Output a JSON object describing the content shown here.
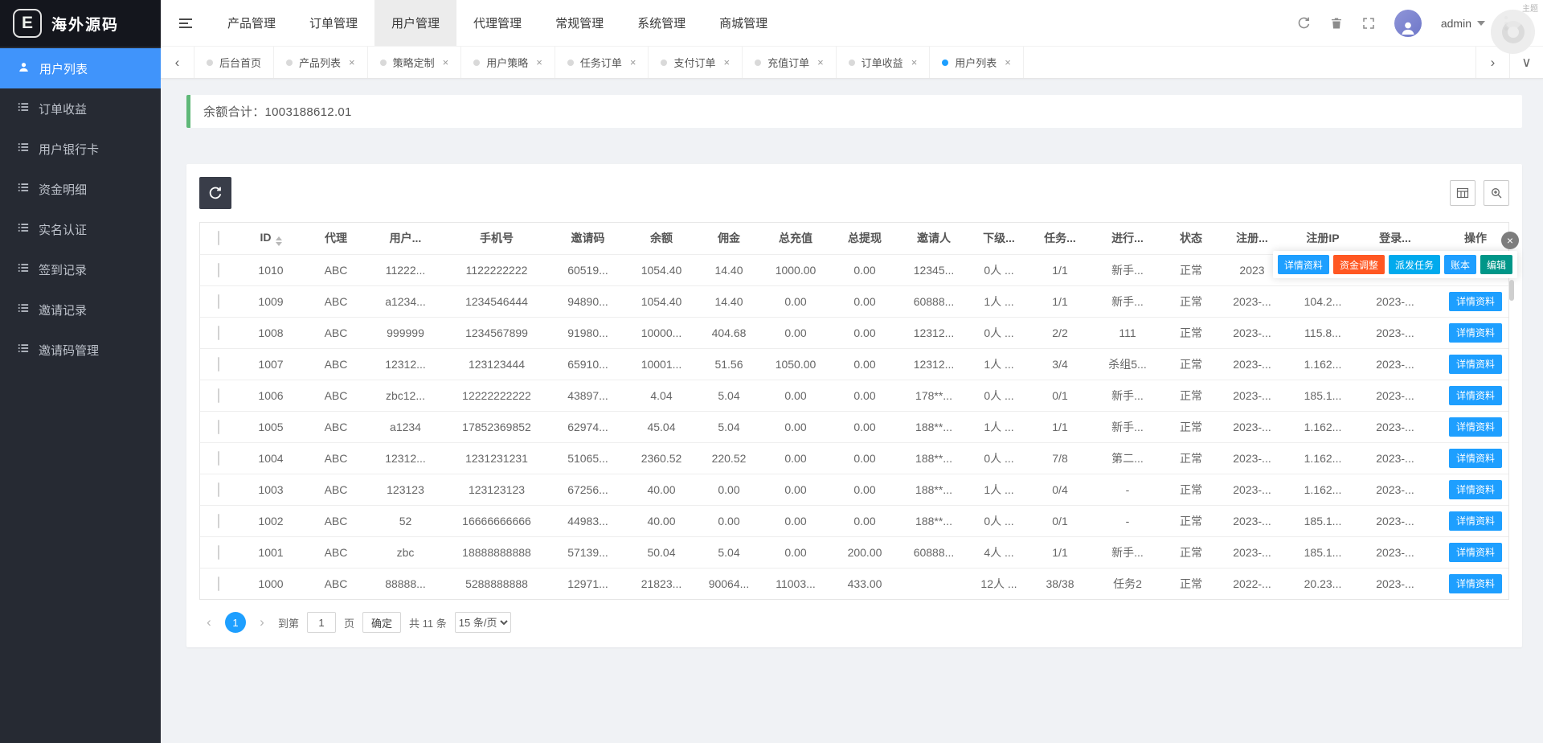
{
  "brand": {
    "logo": "E",
    "name": "海外源码"
  },
  "header": {
    "nav": [
      {
        "label": "产品管理",
        "active": false
      },
      {
        "label": "订单管理",
        "active": false
      },
      {
        "label": "用户管理",
        "active": true
      },
      {
        "label": "代理管理",
        "active": false
      },
      {
        "label": "常规管理",
        "active": false
      },
      {
        "label": "系统管理",
        "active": false
      },
      {
        "label": "商城管理",
        "active": false
      }
    ],
    "username": "admin",
    "theme": "主题"
  },
  "tabs": [
    {
      "label": "后台首页",
      "closable": false,
      "active": false
    },
    {
      "label": "产品列表",
      "closable": true,
      "active": false
    },
    {
      "label": "策略定制",
      "closable": true,
      "active": false
    },
    {
      "label": "用户策略",
      "closable": true,
      "active": false
    },
    {
      "label": "任务订单",
      "closable": true,
      "active": false
    },
    {
      "label": "支付订单",
      "closable": true,
      "active": false
    },
    {
      "label": "充值订单",
      "closable": true,
      "active": false
    },
    {
      "label": "订单收益",
      "closable": true,
      "active": false
    },
    {
      "label": "用户列表",
      "closable": true,
      "active": true
    }
  ],
  "sidebar": {
    "items": [
      {
        "label": "用户列表",
        "active": true
      },
      {
        "label": "订单收益",
        "active": false
      },
      {
        "label": "用户银行卡",
        "active": false
      },
      {
        "label": "资金明细",
        "active": false
      },
      {
        "label": "实名认证",
        "active": false
      },
      {
        "label": "签到记录",
        "active": false
      },
      {
        "label": "邀请记录",
        "active": false
      },
      {
        "label": "邀请码管理",
        "active": false
      }
    ]
  },
  "summary": {
    "label": "余额合计：",
    "value": "1003188612.01"
  },
  "table": {
    "headers": [
      "ID",
      "代理",
      "用户...",
      "手机号",
      "邀请码",
      "余额",
      "佣金",
      "总充值",
      "总提现",
      "邀请人",
      "下级...",
      "任务...",
      "进行...",
      "状态",
      "注册...",
      "注册IP",
      "登录...",
      "操作"
    ],
    "rows": [
      {
        "cells": [
          "1010",
          "ABC",
          "11222...",
          "1122222222",
          "60519...",
          "1054.40",
          "14.40",
          "1000.00",
          "0.00",
          "12345...",
          "0人 ...",
          "1/1",
          "新手...",
          "正常",
          "2023",
          "",
          ""
        ],
        "action": ""
      },
      {
        "cells": [
          "1009",
          "ABC",
          "a1234...",
          "1234546444",
          "94890...",
          "1054.40",
          "14.40",
          "0.00",
          "0.00",
          "60888...",
          "1人 ...",
          "1/1",
          "新手...",
          "正常",
          "2023-...",
          "104.2...",
          "2023-..."
        ],
        "action": "详情资料"
      },
      {
        "cells": [
          "1008",
          "ABC",
          "999999",
          "1234567899",
          "91980...",
          "10000...",
          "404.68",
          "0.00",
          "0.00",
          "12312...",
          "0人 ...",
          "2/2",
          "111",
          "正常",
          "2023-...",
          "115.8...",
          "2023-..."
        ],
        "action": "详情资料"
      },
      {
        "cells": [
          "1007",
          "ABC",
          "12312...",
          "123123444",
          "65910...",
          "10001...",
          "51.56",
          "1050.00",
          "0.00",
          "12312...",
          "1人 ...",
          "3/4",
          "杀组5...",
          "正常",
          "2023-...",
          "1.162...",
          "2023-..."
        ],
        "action": "详情资料"
      },
      {
        "cells": [
          "1006",
          "ABC",
          "zbc12...",
          "12222222222",
          "43897...",
          "4.04",
          "5.04",
          "0.00",
          "0.00",
          "178**...",
          "0人 ...",
          "0/1",
          "新手...",
          "正常",
          "2023-...",
          "185.1...",
          "2023-..."
        ],
        "action": "详情资料"
      },
      {
        "cells": [
          "1005",
          "ABC",
          "a1234",
          "17852369852",
          "62974...",
          "45.04",
          "5.04",
          "0.00",
          "0.00",
          "188**...",
          "1人 ...",
          "1/1",
          "新手...",
          "正常",
          "2023-...",
          "1.162...",
          "2023-..."
        ],
        "action": "详情资料"
      },
      {
        "cells": [
          "1004",
          "ABC",
          "12312...",
          "1231231231",
          "51065...",
          "2360.52",
          "220.52",
          "0.00",
          "0.00",
          "188**...",
          "0人 ...",
          "7/8",
          "第二...",
          "正常",
          "2023-...",
          "1.162...",
          "2023-..."
        ],
        "action": "详情资料"
      },
      {
        "cells": [
          "1003",
          "ABC",
          "123123",
          "123123123",
          "67256...",
          "40.00",
          "0.00",
          "0.00",
          "0.00",
          "188**...",
          "1人 ...",
          "0/4",
          "-",
          "正常",
          "2023-...",
          "1.162...",
          "2023-..."
        ],
        "action": "详情资料"
      },
      {
        "cells": [
          "1002",
          "ABC",
          "52",
          "16666666666",
          "44983...",
          "40.00",
          "0.00",
          "0.00",
          "0.00",
          "188**...",
          "0人 ...",
          "0/1",
          "-",
          "正常",
          "2023-...",
          "185.1...",
          "2023-..."
        ],
        "action": "详情资料"
      },
      {
        "cells": [
          "1001",
          "ABC",
          "zbc",
          "18888888888",
          "57139...",
          "50.04",
          "5.04",
          "0.00",
          "200.00",
          "60888...",
          "4人 ...",
          "1/1",
          "新手...",
          "正常",
          "2023-...",
          "185.1...",
          "2023-..."
        ],
        "action": "详情资料"
      },
      {
        "cells": [
          "1000",
          "ABC",
          "88888...",
          "5288888888",
          "12971...",
          "21823...",
          "90064...",
          "11003...",
          "433.00",
          "",
          "12人 ...",
          "38/38",
          "任务2",
          "正常",
          "2022-...",
          "20.23...",
          "2023-..."
        ],
        "action": "详情资料"
      }
    ]
  },
  "popup": {
    "buttons": [
      {
        "label": "详情资料",
        "color": "#1E9FFF"
      },
      {
        "label": "资金调整",
        "color": "#FF5722"
      },
      {
        "label": "派发任务",
        "color": "#01AAED"
      },
      {
        "label": "账本",
        "color": "#1E9FFF"
      },
      {
        "label": "编辑",
        "color": "#009688"
      }
    ]
  },
  "pagination": {
    "page": "1",
    "goto_label": "到第",
    "input_value": "1",
    "page_unit": "页",
    "confirm": "确定",
    "total": "共 11 条",
    "per_page": "15 条/页"
  },
  "colors": {
    "primary": "#1E9FFF",
    "sidebar_active": "#4094FB",
    "summary_green": "#5FB878",
    "danger": "#FF5722",
    "cyan": "#01AAED",
    "green": "#009688"
  }
}
